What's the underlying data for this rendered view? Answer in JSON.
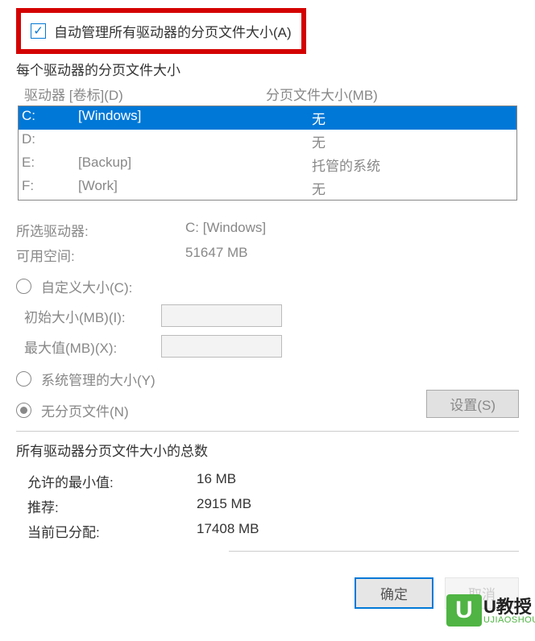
{
  "auto_manage": {
    "label": "自动管理所有驱动器的分页文件大小(A)",
    "checked": true
  },
  "per_drive_label": "每个驱动器的分页文件大小",
  "headers": {
    "drive": "驱动器 [卷标](D)",
    "size": "分页文件大小(MB)"
  },
  "drives": [
    {
      "letter": "C:",
      "label": "[Windows]",
      "size": "无",
      "selected": true
    },
    {
      "letter": "D:",
      "label": "",
      "size": "无",
      "selected": false
    },
    {
      "letter": "E:",
      "label": "[Backup]",
      "size": "托管的系统",
      "selected": false
    },
    {
      "letter": "F:",
      "label": "[Work]",
      "size": "无",
      "selected": false
    }
  ],
  "selected_drive": {
    "label_key": "所选驱动器:",
    "label_val": "C:  [Windows]",
    "space_key": "可用空间:",
    "space_val": "51647 MB"
  },
  "custom_size": {
    "radio_label": "自定义大小(C):",
    "initial_label": "初始大小(MB)(I):",
    "max_label": "最大值(MB)(X):"
  },
  "system_managed_label": "系统管理的大小(Y)",
  "no_paging_label": "无分页文件(N)",
  "no_paging_selected": true,
  "set_button": "设置(S)",
  "totals_label": "所有驱动器分页文件大小的总数",
  "totals": {
    "min_key": "允许的最小值:",
    "min_val": "16 MB",
    "rec_key": "推荐:",
    "rec_val": "2915 MB",
    "cur_key": "当前已分配:",
    "cur_val": "17408 MB"
  },
  "buttons": {
    "ok": "确定",
    "cancel": "取消"
  },
  "watermark": {
    "logo": "U",
    "text": "U教授",
    "url": "UJIAOSHOU.COM"
  }
}
